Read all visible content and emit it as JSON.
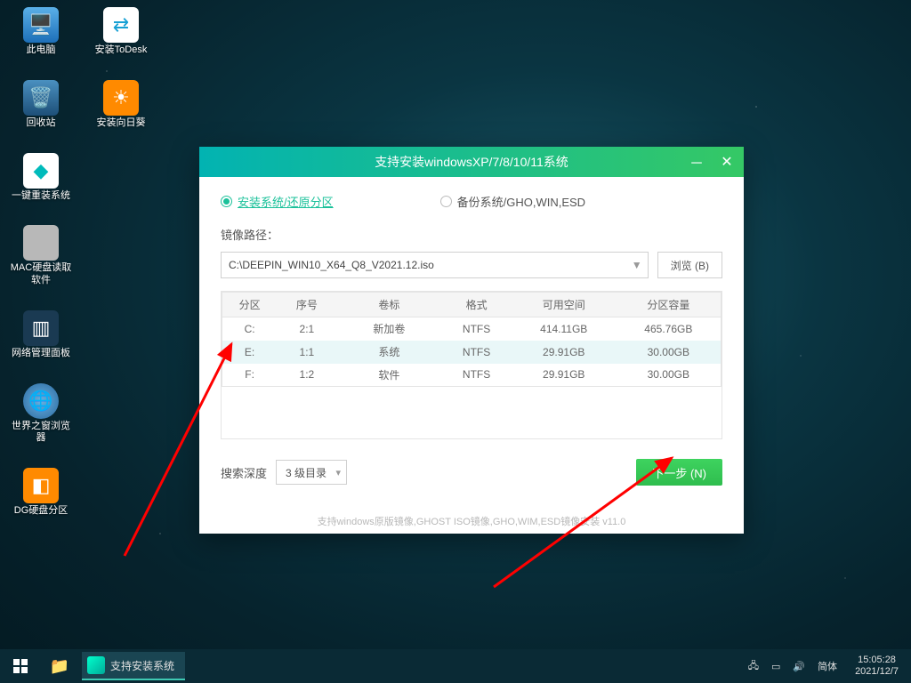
{
  "desktop": {
    "row1": [
      {
        "label": "此电脑",
        "bg": "#1d6fb8"
      },
      {
        "label": "安装ToDesk",
        "bg": "#ffffff"
      }
    ],
    "row2": [
      {
        "label": "回收站",
        "bg": "#1d6fb8"
      },
      {
        "label": "安装向日葵",
        "bg": "#ff8a00"
      }
    ],
    "col": [
      {
        "label": "一键重装系统",
        "bg": "#ffffff"
      },
      {
        "label": "MAC硬盘读取软件",
        "bg": "#b8b8b8"
      },
      {
        "label": "网络管理面板",
        "bg": "#1a3a52"
      },
      {
        "label": "世界之窗浏览器",
        "bg": "#2a6aa0"
      },
      {
        "label": "DG硬盘分区",
        "bg": "#ff8a00"
      }
    ]
  },
  "dialog": {
    "title": "支持安装windowsXP/7/8/10/11系统",
    "radio_install": "安装系统/还原分区",
    "radio_backup": "备份系统/GHO,WIN,ESD",
    "path_label": "镜像路径：",
    "path_value": "C:\\DEEPIN_WIN10_X64_Q8_V2021.12.iso",
    "browse_button": "浏览 (B)",
    "table_headers": [
      "分区",
      "序号",
      "卷标",
      "格式",
      "可用空间",
      "分区容量"
    ],
    "rows": [
      {
        "p": "C:",
        "n": "2:1",
        "v": "新加卷",
        "f": "NTFS",
        "free": "414.11GB",
        "cap": "465.76GB",
        "sel": false
      },
      {
        "p": "E:",
        "n": "1:1",
        "v": "系统",
        "f": "NTFS",
        "free": "29.91GB",
        "cap": "30.00GB",
        "sel": true
      },
      {
        "p": "F:",
        "n": "1:2",
        "v": "软件",
        "f": "NTFS",
        "free": "29.91GB",
        "cap": "30.00GB",
        "sel": false
      }
    ],
    "search_depth_label": "搜索深度",
    "search_depth_value": "3 级目录",
    "next_button": "下一步 (N)",
    "footer_text": "支持windows原版镜像,GHOST ISO镜像,GHO,WIM,ESD镜像安装 v11.0"
  },
  "taskbar": {
    "app_label": "支持安装系统",
    "ime": "简体",
    "time": "15:05:28",
    "date": "2021/12/7"
  }
}
